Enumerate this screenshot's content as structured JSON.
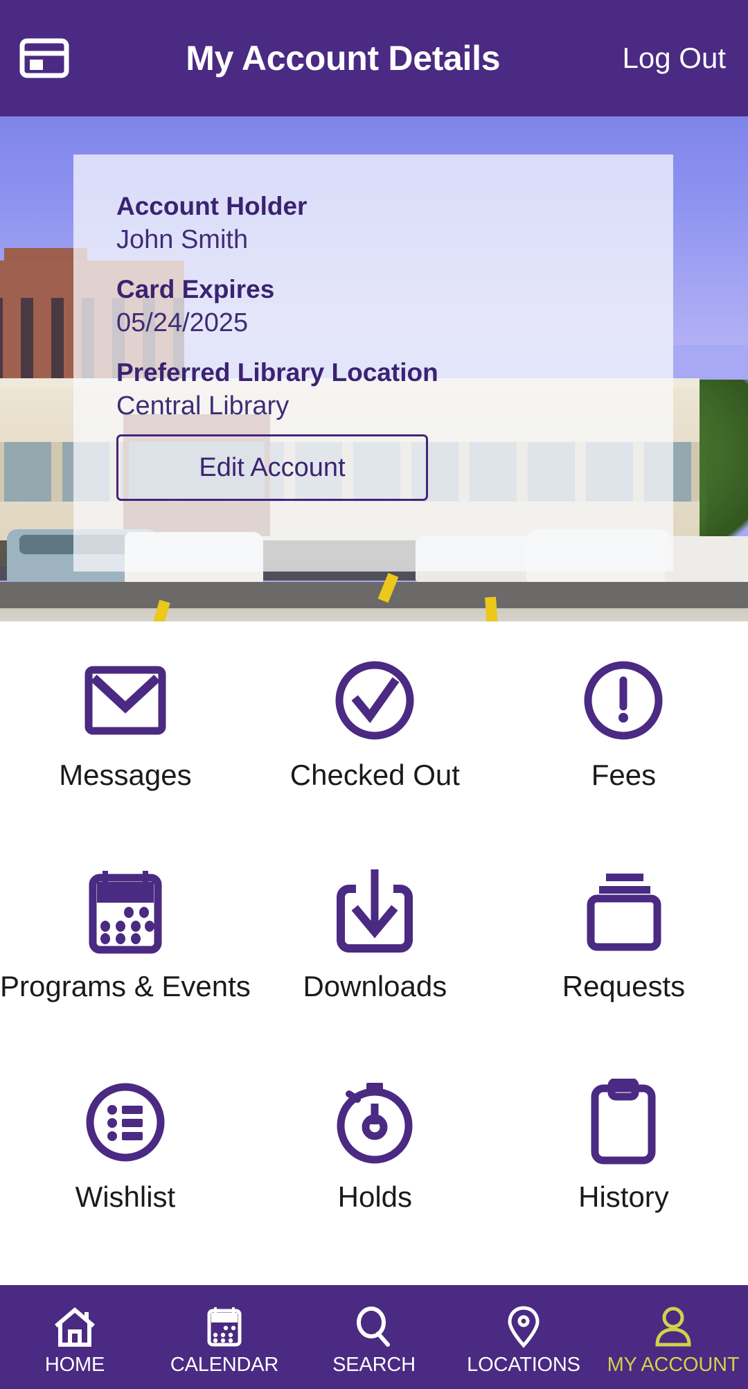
{
  "header": {
    "card_icon": "library-card-icon",
    "title": "My Account Details",
    "logout_label": "Log Out"
  },
  "hero": {
    "card": {
      "account_holder_label": "Account Holder",
      "account_holder_value": " John Smith",
      "card_expires_label": "Card Expires",
      "card_expires_value": "05/24/2025",
      "preferred_location_label": "Preferred Library Location",
      "preferred_location_value": "Central Library",
      "edit_button_label": "Edit Account"
    }
  },
  "grid": {
    "tiles": [
      {
        "label": "Messages",
        "icon": "envelope-icon"
      },
      {
        "label": "Checked Out",
        "icon": "check-circle-icon"
      },
      {
        "label": "Fees",
        "icon": "exclamation-circle-icon"
      },
      {
        "label": "Programs & Events",
        "icon": "calendar-icon"
      },
      {
        "label": "Downloads",
        "icon": "download-icon"
      },
      {
        "label": "Requests",
        "icon": "stacked-boxes-icon"
      },
      {
        "label": "Wishlist",
        "icon": "list-circle-icon"
      },
      {
        "label": "Holds",
        "icon": "stopwatch-icon"
      },
      {
        "label": "History",
        "icon": "clipboard-icon"
      }
    ]
  },
  "bottom_nav": {
    "items": [
      {
        "label": "HOME",
        "icon": "home-icon",
        "active": false
      },
      {
        "label": "CALENDAR",
        "icon": "calendar-icon",
        "active": false
      },
      {
        "label": "SEARCH",
        "icon": "search-icon",
        "active": false
      },
      {
        "label": "LOCATIONS",
        "icon": "pin-icon",
        "active": false
      },
      {
        "label": "MY ACCOUNT",
        "icon": "person-icon",
        "active": true
      }
    ]
  },
  "colors": {
    "brand_purple": "#4a2a82",
    "icon_purple": "#4a2a82",
    "text_purple": "#3c2271",
    "accent_yellow": "#d2d14b",
    "page_background": "#ffffff",
    "label_text": "#1a1a1a"
  }
}
